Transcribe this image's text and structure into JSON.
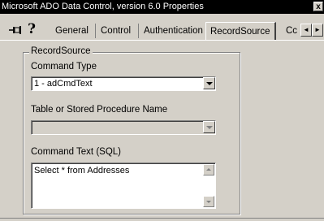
{
  "window": {
    "title": "Microsoft ADO Data Control, version 6.0 Properties",
    "close_glyph": "x"
  },
  "toolbar": {
    "pin_icon": "pin-icon",
    "help_icon": "help-icon",
    "help_glyph": "?"
  },
  "tabs": [
    {
      "label": "General",
      "active": false
    },
    {
      "label": "Control",
      "active": false
    },
    {
      "label": "Authentication",
      "active": false
    },
    {
      "label": "RecordSource",
      "active": true
    },
    {
      "label": "Cc",
      "active": false
    }
  ],
  "tab_scroll": {
    "left_glyph": "◄",
    "right_glyph": "►"
  },
  "group": {
    "legend": "RecordSource",
    "command_type_label": "Command Type",
    "command_type_value": "1 - adCmdText",
    "table_label": "Table or Stored Procedure Name",
    "table_value": "",
    "command_text_label": "Command Text (SQL)",
    "command_text_value": "Select * from Addresses"
  },
  "colors": {
    "face": "#d4d0c8",
    "titlebar": "#000000",
    "field": "#ffffff"
  }
}
